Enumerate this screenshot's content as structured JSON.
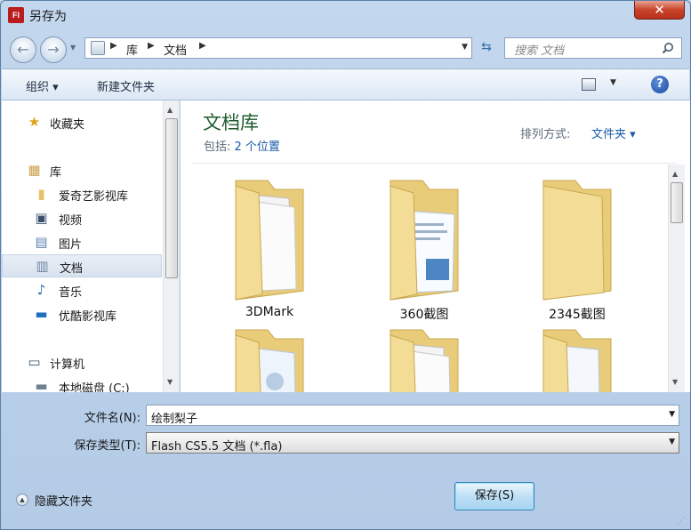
{
  "window": {
    "title": "另存为",
    "app_icon_text": "Fl",
    "close_glyph": "✕"
  },
  "address": {
    "crumbs": [
      "库",
      "文档"
    ],
    "search_placeholder": "搜索 文档"
  },
  "toolbar": {
    "organize": "组织 ▾",
    "new_folder": "新建文件夹",
    "help": "?"
  },
  "nav": {
    "favorites": "收藏夹",
    "libraries": "库",
    "library_items": [
      "爱奇艺影视库",
      "视频",
      "图片",
      "文档",
      "音乐",
      "优酷影视库"
    ],
    "computer": "计算机",
    "drive": "本地磁盘 (C:)",
    "selected": "文档"
  },
  "content": {
    "title": "文档库",
    "includes_label": "包括:",
    "includes_link": "2 个位置",
    "arrange_label": "排列方式:",
    "arrange_value": "文件夹 ▾",
    "folders": [
      {
        "name": "3DMark",
        "style": "papers"
      },
      {
        "name": "360截图",
        "style": "screenshots"
      },
      {
        "name": "2345截图",
        "style": "empty"
      },
      {
        "name": "",
        "style": "papers-blue"
      },
      {
        "name": "",
        "style": "papers"
      },
      {
        "name": "",
        "style": "files"
      }
    ]
  },
  "form": {
    "filename_label": "文件名(N):",
    "filename_value": "绘制梨子",
    "type_label": "保存类型(T):",
    "type_value": "Flash CS5.5 文档 (*.fla)"
  },
  "footer": {
    "hide_folders": "隐藏文件夹",
    "save": "保存(S)"
  },
  "colors": {
    "accent": "#1a5aa8",
    "library_title": "#1e5c2d",
    "folder": "#f2d98c"
  }
}
